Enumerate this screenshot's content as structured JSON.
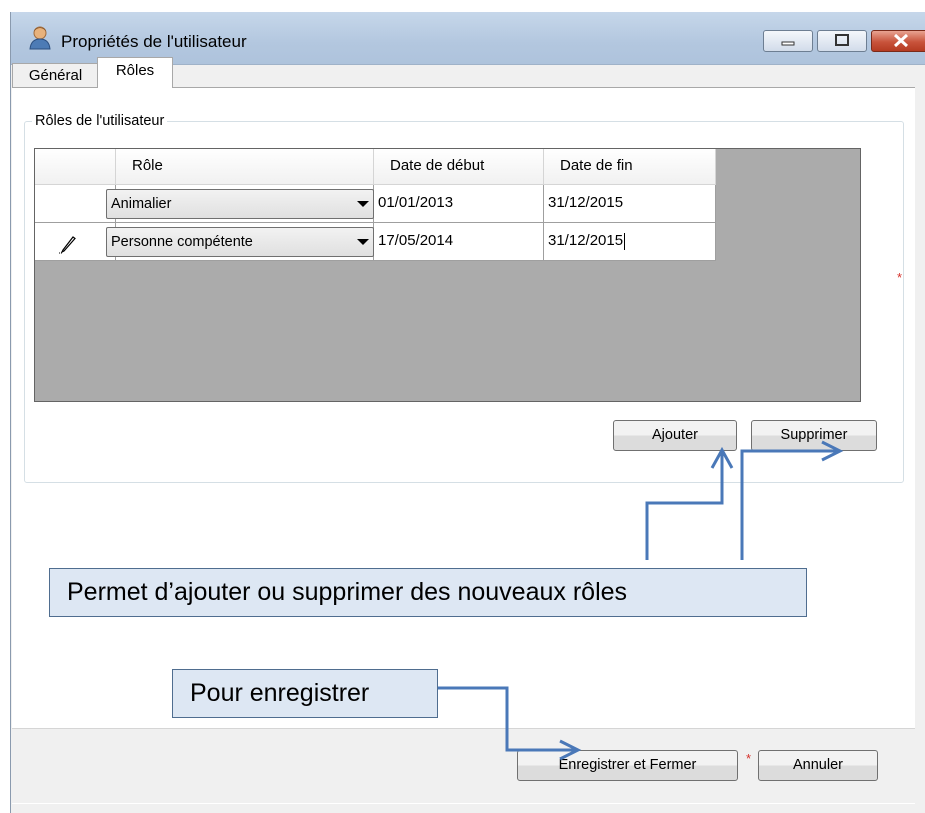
{
  "window": {
    "title": "Propriétés de l'utilisateur"
  },
  "tabs": [
    {
      "label": "Général",
      "active": false
    },
    {
      "label": "Rôles",
      "active": true
    }
  ],
  "group": {
    "title": "Rôles de l'utilisateur"
  },
  "grid": {
    "columns": [
      "Rôle",
      "Date de début",
      "Date de fin"
    ],
    "rows": [
      {
        "role": "Animalier",
        "start": "01/01/2013",
        "end": "31/12/2015",
        "editing": false
      },
      {
        "role": "Personne compétente",
        "start": "17/05/2014",
        "end": "31/12/2015",
        "editing": true
      }
    ]
  },
  "buttons": {
    "add": "Ajouter",
    "remove": "Supprimer",
    "save": "Enregistrer et Fermer",
    "cancel": "Annuler"
  },
  "annotations": {
    "roles_note": "Permet d’ajouter ou supprimer des nouveaux rôles",
    "save_note": "Pour enregistrer"
  },
  "colors": {
    "callout_bg": "#dde7f3",
    "arrow": "#4a78b8",
    "required_asterisk": "#d6302a"
  }
}
